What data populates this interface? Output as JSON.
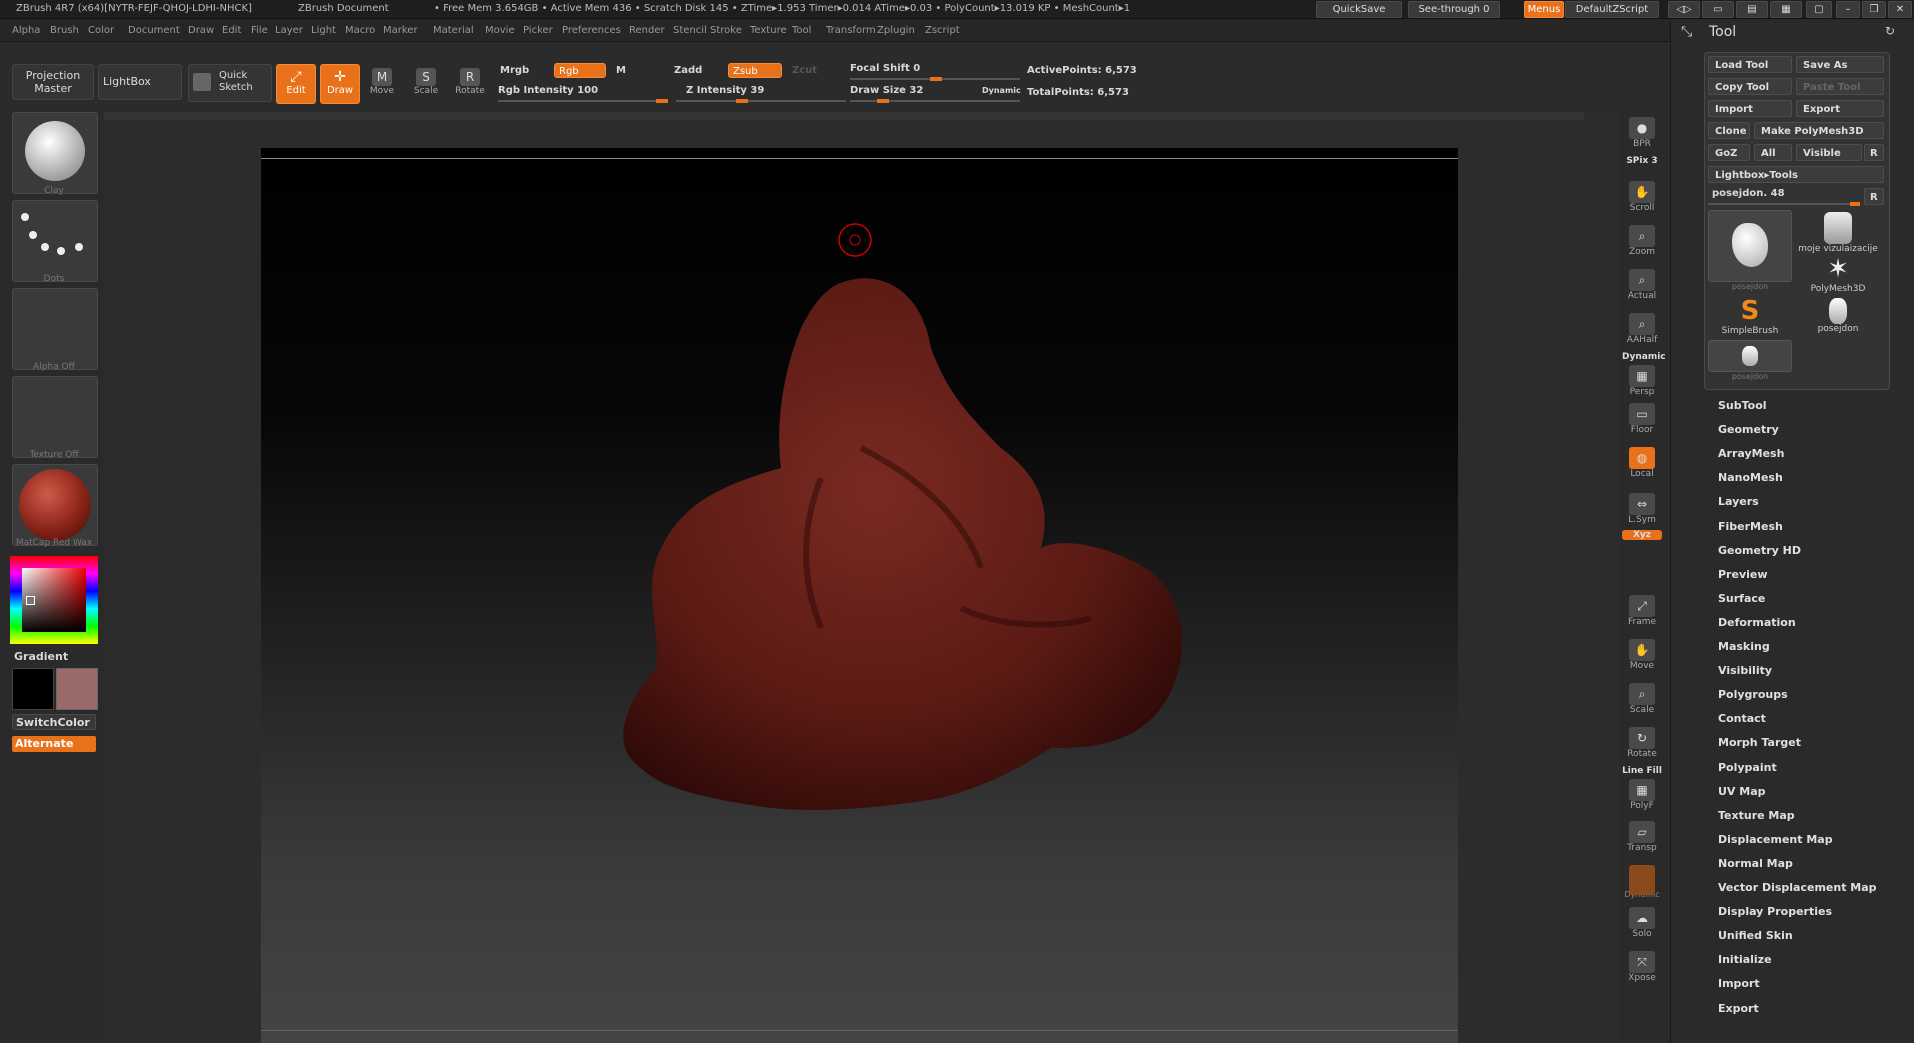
{
  "titlebar": {
    "app": "ZBrush 4R7 (x64)[NYTR-FEJF-QHOJ-LDHI-NHCK]",
    "doc": "ZBrush Document",
    "stats": "• Free Mem 3.654GB • Active Mem 436 • Scratch Disk 145 •  ZTime▸1.953 Timer▸0.014 ATime▸0.03 • PolyCount▸13.019 KP  • MeshCount▸1",
    "quicksave": "QuickSave",
    "seethrough": "See-through  0",
    "menus": "Menus",
    "defaultzscript": "DefaultZScript"
  },
  "menubar": [
    "Alpha",
    "Brush",
    "Color",
    "Document",
    "Draw",
    "Edit",
    "File",
    "Layer",
    "Light",
    "Macro",
    "Marker",
    "Material",
    "Movie",
    "Picker",
    "Preferences",
    "Render",
    "Stencil",
    "Stroke",
    "Texture",
    "Tool",
    "Transform",
    "Zplugin",
    "Zscript"
  ],
  "shelf": {
    "projection_master": "Projection Master",
    "lightbox": "LightBox",
    "quick_sketch": "Quick Sketch",
    "edit": "Edit",
    "draw": "Draw",
    "move": "Move",
    "scale": "Scale",
    "rotate": "Rotate",
    "mrgb": "Mrgb",
    "rgb": "Rgb",
    "m": "M",
    "rgb_intensity": "Rgb  Intensity 100",
    "zadd": "Zadd",
    "zsub": "Zsub",
    "zcut": "Zcut",
    "z_intensity": "Z Intensity 39",
    "focal_shift": "Focal Shift 0",
    "draw_size": "Draw Size 32",
    "dynamic": "Dynamic",
    "active_points": "ActivePoints: 6,573",
    "total_points": "TotalPoints: 6,573",
    "rgb_intensity_value": 100,
    "z_intensity_value": 39,
    "draw_size_value": 32
  },
  "lefttray": {
    "clay": "Clay",
    "dots": "Dots",
    "alpha": "Alpha  Off",
    "texture": "Texture  Off",
    "matcap": "MatCap  Red  Wax",
    "gradient": "Gradient",
    "switchcolor": "SwitchColor",
    "alternate": "Alternate"
  },
  "rightshelf": [
    "BPR",
    "SPix 3",
    "Scroll",
    "Zoom",
    "Actual",
    "AAHalf",
    "Dynamic",
    "Persp",
    "Floor",
    "Local",
    "L.Sym",
    "Xyz",
    "Frame",
    "Move",
    "Scale",
    "Rotate",
    "Line Fill",
    "PolyF",
    "Transp",
    "Dynamic",
    "Solo",
    "Xpose"
  ],
  "toolpanel": {
    "title": "Tool",
    "load_tool": "Load Tool",
    "save_as": "Save As",
    "copy_tool": "Copy Tool",
    "paste_tool": "Paste Tool",
    "import": "Import",
    "export": "Export",
    "clone": "Clone",
    "make_polymesh": "Make PolyMesh3D",
    "goz": "GoZ",
    "all": "All",
    "visible": "Visible",
    "r": "R",
    "lightbox_tools": "Lightbox▸Tools",
    "current_tool": "posejdon. 48",
    "tools": [
      {
        "label": "posejdon"
      },
      {
        "label": "moje  vizulaizacije"
      },
      {
        "label": "PolyMesh3D"
      },
      {
        "label": "SimpleBrush"
      },
      {
        "label": "posejdon"
      },
      {
        "label": "posejdon"
      }
    ],
    "menu": [
      "SubTool",
      "Geometry",
      "ArrayMesh",
      "NanoMesh",
      "Layers",
      "FiberMesh",
      "Geometry HD",
      "Preview",
      "Surface",
      "Deformation",
      "Masking",
      "Visibility",
      "Polygroups",
      "Contact",
      "Morph Target",
      "Polypaint",
      "UV Map",
      "Texture Map",
      "Displacement Map",
      "Normal Map",
      "Vector Displacement Map",
      "Display Properties",
      "Unified Skin",
      "Initialize",
      "Import",
      "Export"
    ]
  },
  "colors": {
    "accent": "#e8711a",
    "mesh": "#6b1e18",
    "secondary_color": "#9b6b6b"
  }
}
